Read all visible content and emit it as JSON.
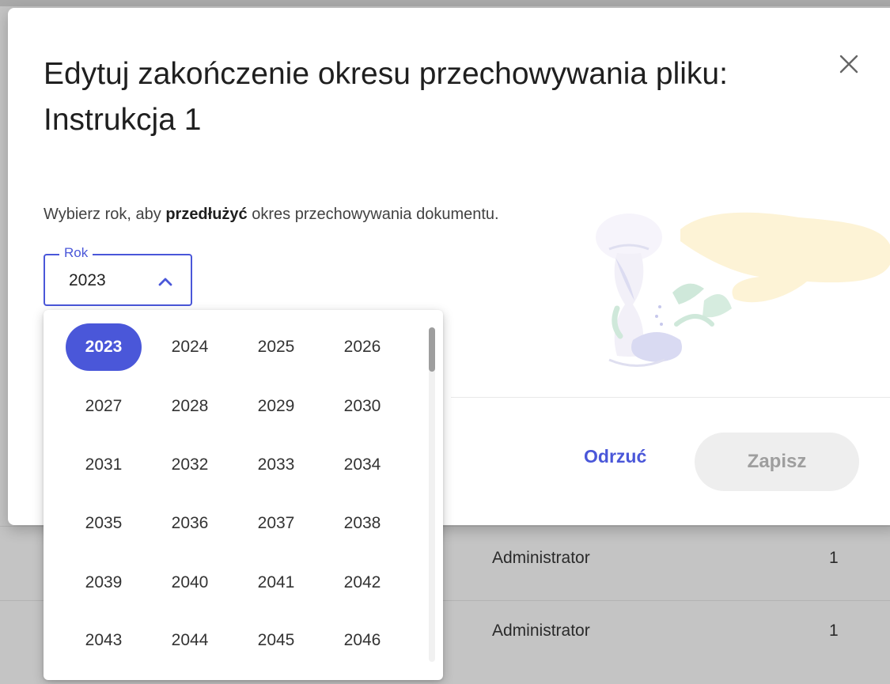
{
  "background_table": {
    "rows": [
      {
        "user": "Administrator",
        "count": "1"
      },
      {
        "user": "Administrator",
        "count": "1"
      }
    ]
  },
  "dialog": {
    "title": "Edytuj zakończenie okresu przechowywania pliku: Instrukcja 1",
    "description_before": "Wybierz rok, aby ",
    "description_bold": "przedłużyć",
    "description_after": " okres przechowywania dokumentu.",
    "year_field": {
      "label": "Rok",
      "value": "2023",
      "state": "expanded"
    },
    "buttons": {
      "discard": "Odrzuć",
      "save": "Zapisz"
    },
    "save_enabled": false
  },
  "year_picker": {
    "selected": "2023",
    "years": [
      "2023",
      "2024",
      "2025",
      "2026",
      "2027",
      "2028",
      "2029",
      "2030",
      "2031",
      "2032",
      "2033",
      "2034",
      "2035",
      "2036",
      "2037",
      "2038",
      "2039",
      "2040",
      "2041",
      "2042",
      "2043",
      "2044",
      "2045",
      "2046"
    ]
  },
  "colors": {
    "accent": "#4a57d9",
    "save_button_bg": "#eeeeee",
    "save_button_text": "#9e9e9e"
  },
  "icons": {
    "close": "close-icon",
    "chevron": "chevron-up-icon"
  }
}
